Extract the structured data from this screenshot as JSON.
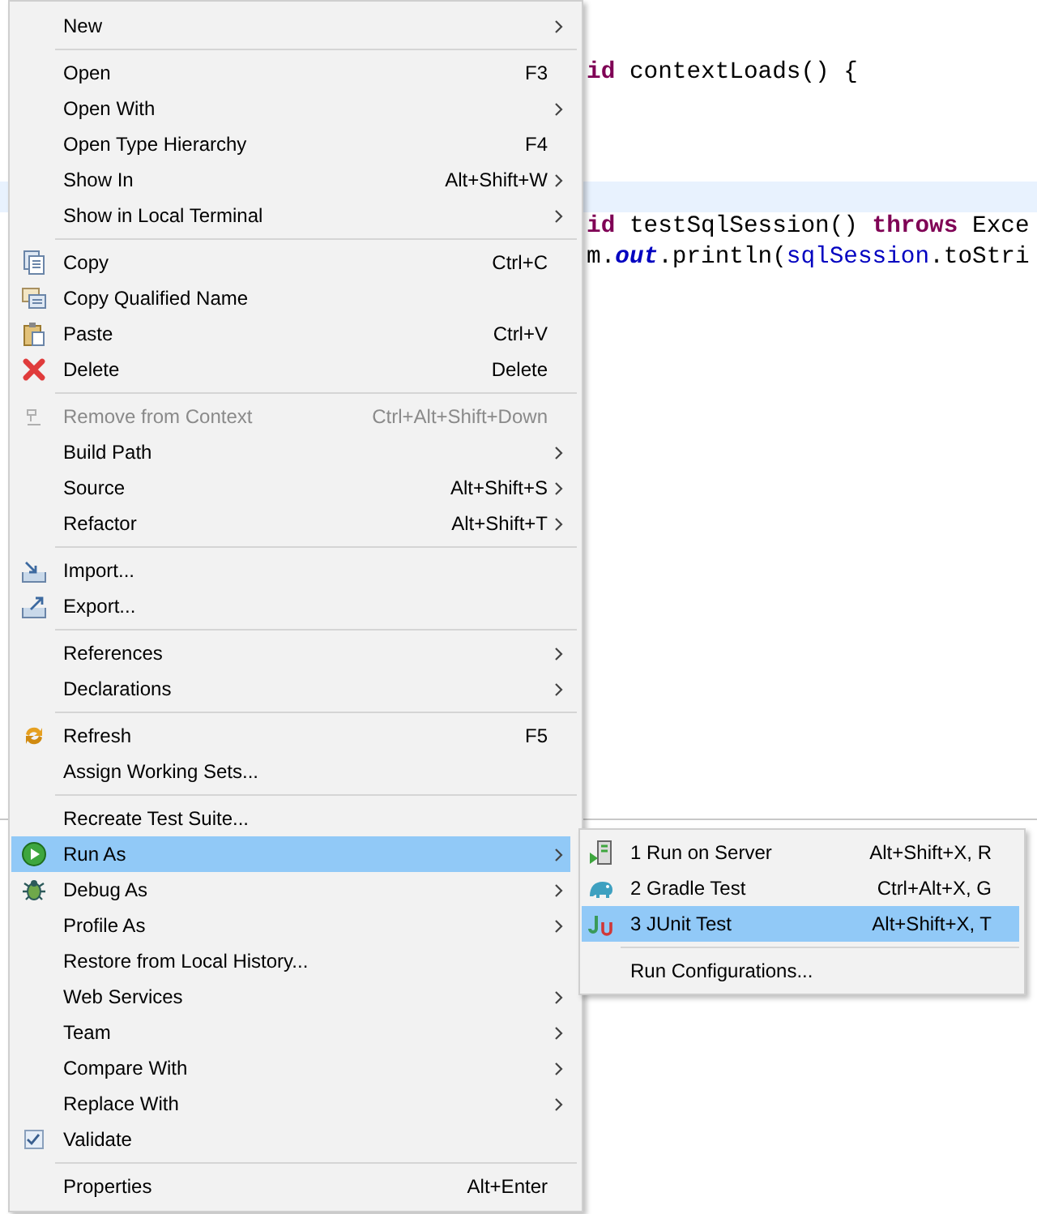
{
  "editor": {
    "lines": [
      {
        "current": false,
        "tokens": [
          {
            "kind": "keyword",
            "text": "id"
          },
          {
            "kind": "plain",
            "text": " contextLoads() {"
          }
        ]
      },
      {
        "current": false
      },
      {
        "current": false
      },
      {
        "current": false
      },
      {
        "current": true
      },
      {
        "current": false,
        "tokens": [
          {
            "kind": "keyword",
            "text": "id"
          },
          {
            "kind": "plain",
            "text": " testSqlSession() "
          },
          {
            "kind": "keyword",
            "text": "throws"
          },
          {
            "kind": "plain",
            "text": " Exce"
          }
        ]
      },
      {
        "current": false,
        "tokens": [
          {
            "kind": "plain",
            "text": "m."
          },
          {
            "kind": "static",
            "text": "out"
          },
          {
            "kind": "plain",
            "text": ".println("
          },
          {
            "kind": "field",
            "text": "sqlSession"
          },
          {
            "kind": "plain",
            "text": ".toStri"
          }
        ]
      }
    ]
  },
  "context_menu": {
    "items": [
      {
        "kind": "item",
        "label": "New",
        "submenu": true,
        "disabled": false,
        "selected": false
      },
      {
        "kind": "separator"
      },
      {
        "kind": "item",
        "label": "Open",
        "shortcut": "F3",
        "submenu": false,
        "disabled": false,
        "selected": false
      },
      {
        "kind": "item",
        "label": "Open With",
        "submenu": true,
        "disabled": false,
        "selected": false
      },
      {
        "kind": "item",
        "label": "Open Type Hierarchy",
        "shortcut": "F4",
        "submenu": false,
        "disabled": false,
        "selected": false
      },
      {
        "kind": "item",
        "label": "Show In",
        "shortcut": "Alt+Shift+W",
        "submenu": true,
        "disabled": false,
        "selected": false
      },
      {
        "kind": "item",
        "label": "Show in Local Terminal",
        "submenu": true,
        "disabled": false,
        "selected": false
      },
      {
        "kind": "separator"
      },
      {
        "kind": "item",
        "label": "Copy",
        "shortcut": "Ctrl+C",
        "submenu": false,
        "disabled": false,
        "selected": false
      },
      {
        "kind": "item",
        "label": "Copy Qualified Name",
        "submenu": false,
        "disabled": false,
        "selected": false
      },
      {
        "kind": "item",
        "label": "Paste",
        "shortcut": "Ctrl+V",
        "submenu": false,
        "disabled": false,
        "selected": false
      },
      {
        "kind": "item",
        "label": "Delete",
        "shortcut": "Delete",
        "submenu": false,
        "disabled": false,
        "selected": false
      },
      {
        "kind": "separator"
      },
      {
        "kind": "item",
        "label": "Remove from Context",
        "shortcut": "Ctrl+Alt+Shift+Down",
        "submenu": false,
        "disabled": true,
        "selected": false
      },
      {
        "kind": "item",
        "label": "Build Path",
        "submenu": true,
        "disabled": false,
        "selected": false
      },
      {
        "kind": "item",
        "label": "Source",
        "shortcut": "Alt+Shift+S",
        "submenu": true,
        "disabled": false,
        "selected": false
      },
      {
        "kind": "item",
        "label": "Refactor",
        "shortcut": "Alt+Shift+T",
        "submenu": true,
        "disabled": false,
        "selected": false
      },
      {
        "kind": "separator"
      },
      {
        "kind": "item",
        "label": "Import...",
        "submenu": false,
        "disabled": false,
        "selected": false
      },
      {
        "kind": "item",
        "label": "Export...",
        "submenu": false,
        "disabled": false,
        "selected": false
      },
      {
        "kind": "separator"
      },
      {
        "kind": "item",
        "label": "References",
        "submenu": true,
        "disabled": false,
        "selected": false
      },
      {
        "kind": "item",
        "label": "Declarations",
        "submenu": true,
        "disabled": false,
        "selected": false
      },
      {
        "kind": "separator"
      },
      {
        "kind": "item",
        "label": "Refresh",
        "shortcut": "F5",
        "submenu": false,
        "disabled": false,
        "selected": false
      },
      {
        "kind": "item",
        "label": "Assign Working Sets...",
        "submenu": false,
        "disabled": false,
        "selected": false
      },
      {
        "kind": "separator"
      },
      {
        "kind": "item",
        "label": "Recreate Test Suite...",
        "submenu": false,
        "disabled": false,
        "selected": false
      },
      {
        "kind": "item",
        "label": "Run As",
        "submenu": true,
        "disabled": false,
        "selected": true
      },
      {
        "kind": "item",
        "label": "Debug As",
        "submenu": true,
        "disabled": false,
        "selected": false
      },
      {
        "kind": "item",
        "label": "Profile As",
        "submenu": true,
        "disabled": false,
        "selected": false
      },
      {
        "kind": "item",
        "label": "Restore from Local History...",
        "submenu": false,
        "disabled": false,
        "selected": false
      },
      {
        "kind": "item",
        "label": "Web Services",
        "submenu": true,
        "disabled": false,
        "selected": false
      },
      {
        "kind": "item",
        "label": "Team",
        "submenu": true,
        "disabled": false,
        "selected": false
      },
      {
        "kind": "item",
        "label": "Compare With",
        "submenu": true,
        "disabled": false,
        "selected": false
      },
      {
        "kind": "item",
        "label": "Replace With",
        "submenu": true,
        "disabled": false,
        "selected": false
      },
      {
        "kind": "check",
        "label": "Validate",
        "checked": true,
        "submenu": false,
        "disabled": false,
        "selected": false
      },
      {
        "kind": "separator"
      },
      {
        "kind": "item",
        "label": "Properties",
        "shortcut": "Alt+Enter",
        "submenu": false,
        "disabled": false,
        "selected": false
      }
    ]
  },
  "run_as_submenu": {
    "items": [
      {
        "kind": "item",
        "label": "1 Run on Server",
        "shortcut": "Alt+Shift+X, R",
        "selected": false
      },
      {
        "kind": "item",
        "label": "2 Gradle Test",
        "shortcut": "Ctrl+Alt+X, G",
        "selected": false
      },
      {
        "kind": "item",
        "label": "3 JUnit Test",
        "shortcut": "Alt+Shift+X, T",
        "selected": true
      },
      {
        "kind": "separator"
      },
      {
        "kind": "item",
        "label": "Run Configurations...",
        "selected": false
      }
    ]
  }
}
